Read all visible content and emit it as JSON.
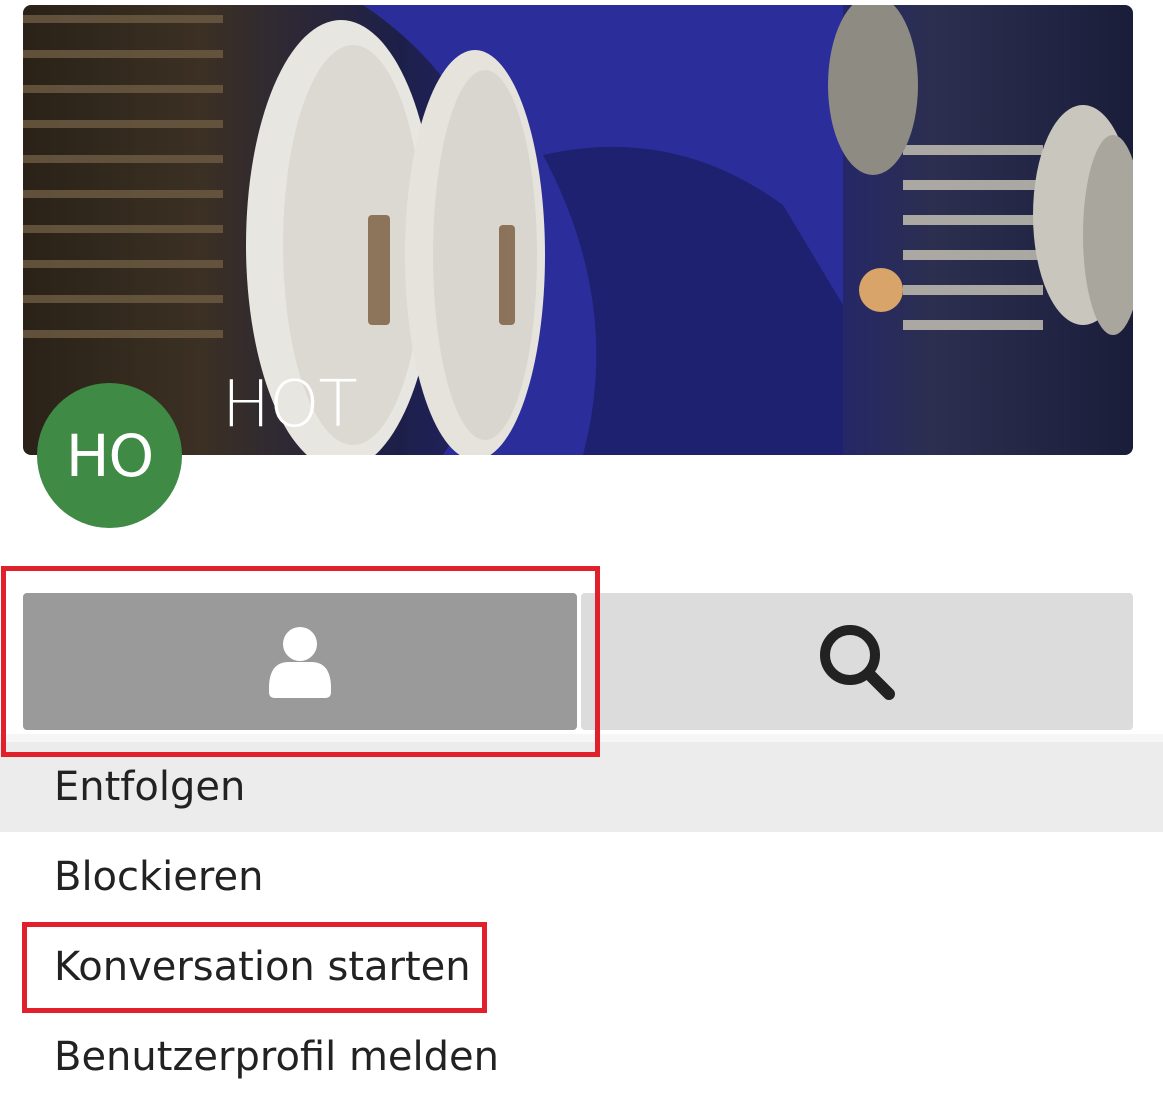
{
  "profile": {
    "name": "HOT",
    "avatar_initials": "HO",
    "avatar_color": "#3f8a45"
  },
  "tabs": [
    {
      "icon": "user-icon",
      "active": true
    },
    {
      "icon": "search-icon",
      "active": false
    }
  ],
  "menu": {
    "items": [
      {
        "label": "Entfolgen"
      },
      {
        "label": "Blockieren"
      },
      {
        "label": "Konversation starten"
      },
      {
        "label": "Benutzerprofil melden"
      }
    ]
  },
  "colors": {
    "highlight": "#e0212b",
    "tab_active": "#9a9a9a",
    "tab_inactive": "#dcdcdc"
  }
}
